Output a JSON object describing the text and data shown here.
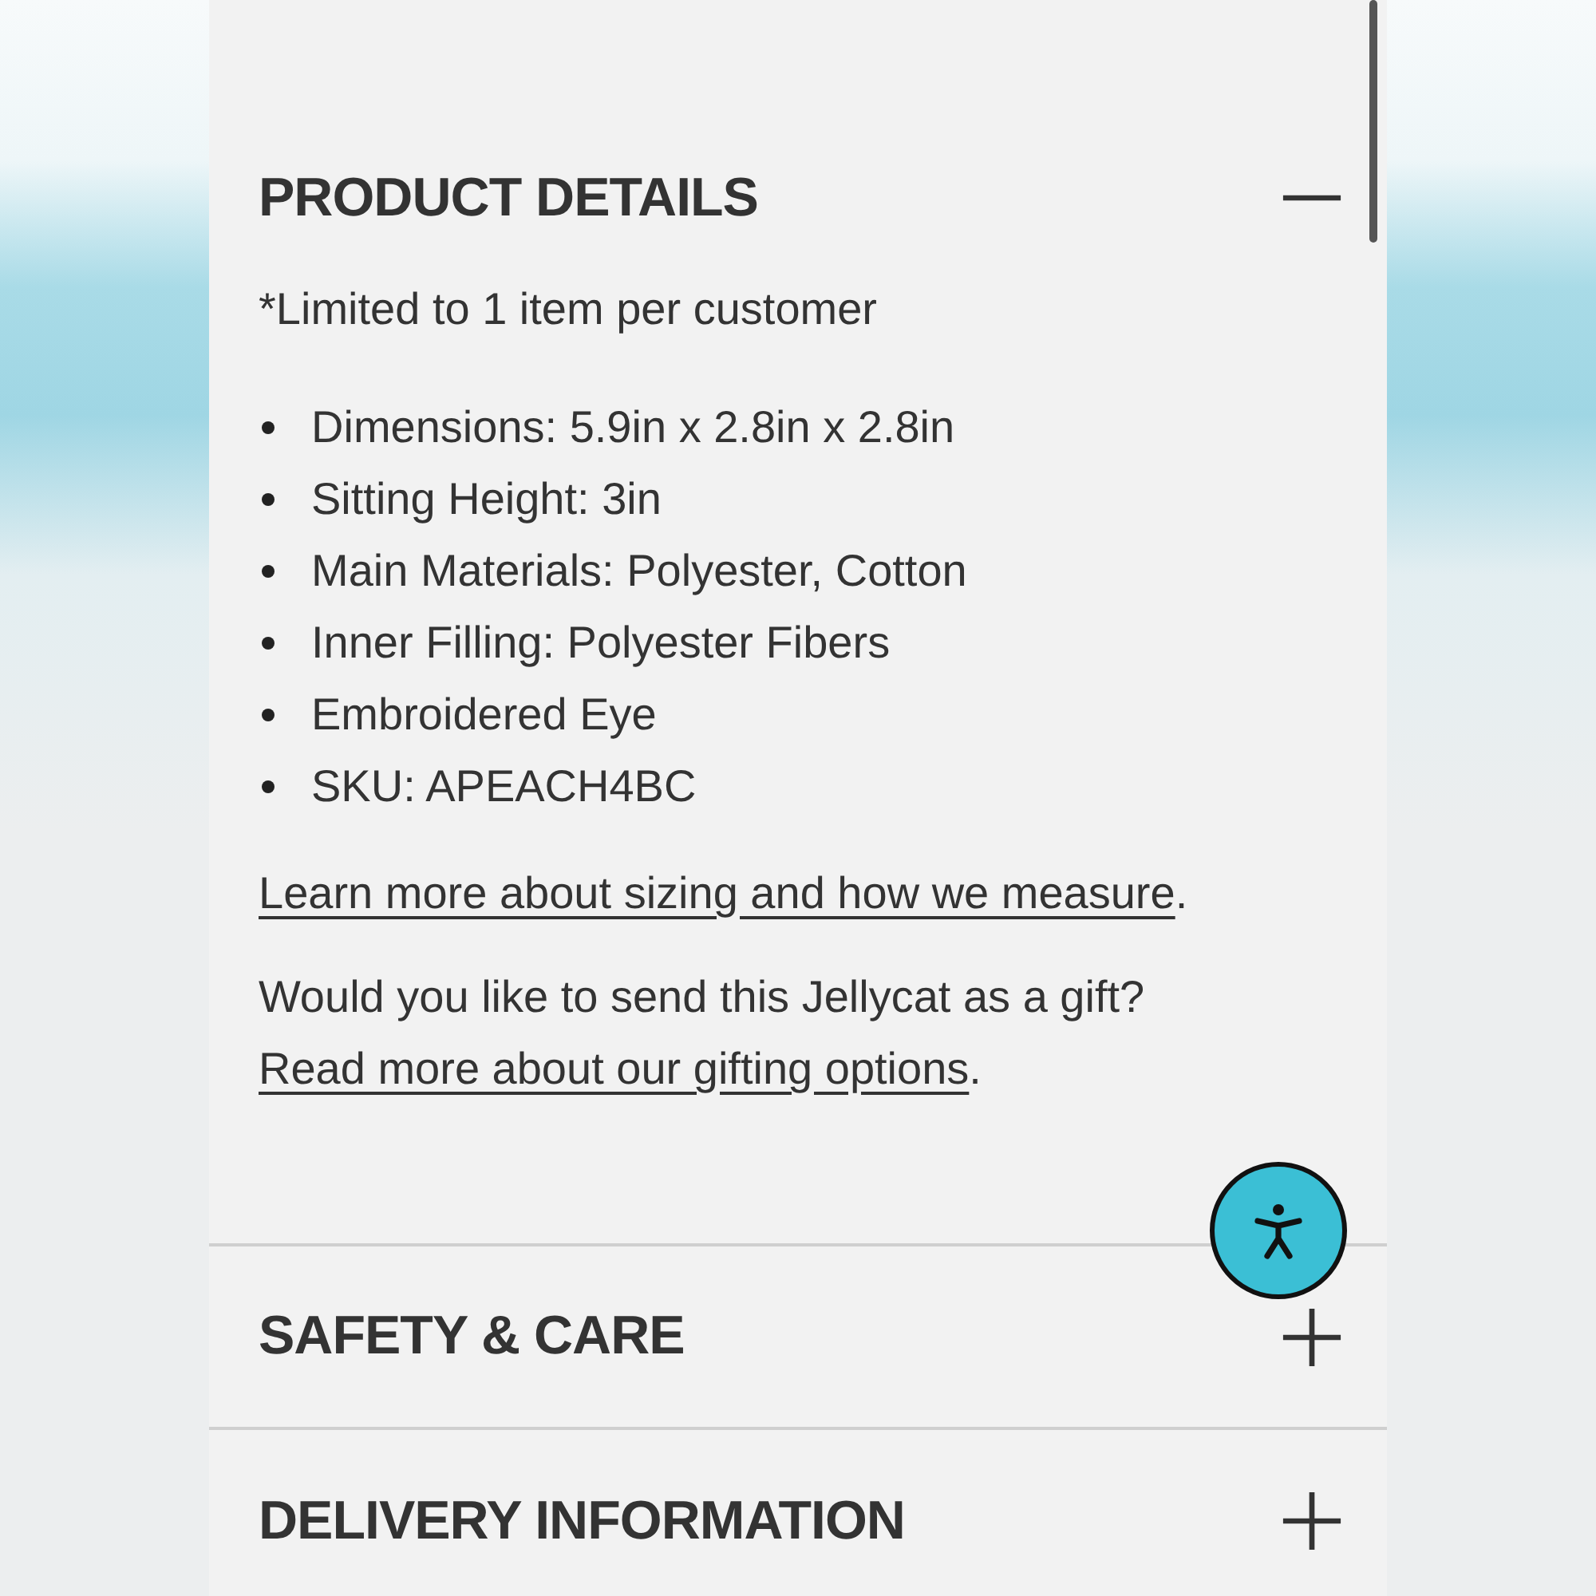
{
  "sections": [
    {
      "title": "PRODUCT DETAILS",
      "expanded": true,
      "note": "*Limited to 1 item per customer",
      "bullets": [
        "Dimensions: 5.9in x 2.8in x 2.8in",
        "Sitting Height: 3in",
        "Main Materials: Polyester, Cotton",
        "Inner Filling: Polyester Fibers",
        "Embroidered Eye",
        "SKU: APEACH4BC"
      ],
      "sizing_link": "Learn more about sizing and how we measure",
      "sizing_suffix": ".",
      "gift_text": "Would you like to send this Jellycat as a gift?",
      "gift_link": "Read more about our gifting options",
      "gift_suffix": "."
    },
    {
      "title": "SAFETY & CARE",
      "expanded": false
    },
    {
      "title": "DELIVERY INFORMATION",
      "expanded": false
    }
  ]
}
